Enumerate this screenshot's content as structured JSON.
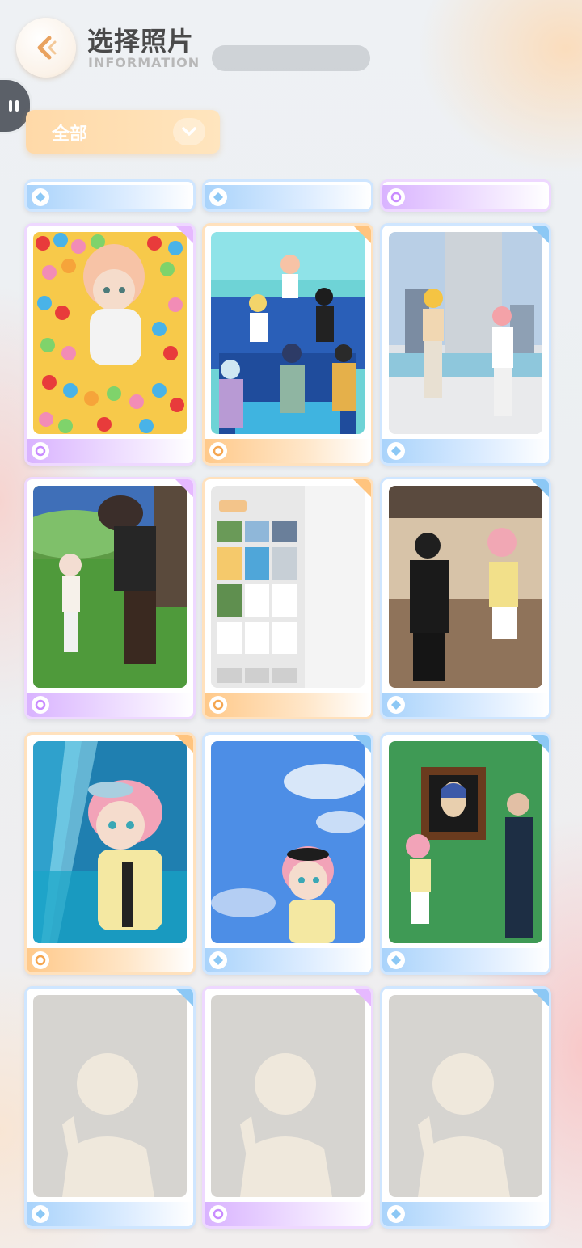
{
  "header": {
    "title": "选择照片",
    "subtitle": "INFORMATION"
  },
  "filter": {
    "selected": "全部"
  },
  "colors": {
    "accent_orange": "#ffd9a8",
    "frame_purple": "#e6b9ff",
    "frame_orange": "#ffc47e",
    "frame_blue": "#8cc8f5"
  },
  "grid": {
    "columns": 3,
    "cards": [
      {
        "frame": "blue",
        "content": "partial"
      },
      {
        "frame": "blue",
        "content": "partial"
      },
      {
        "frame": "purple",
        "content": "partial"
      },
      {
        "frame": "purple",
        "content": "ball-pit"
      },
      {
        "frame": "orange",
        "content": "group-photo"
      },
      {
        "frame": "blue",
        "content": "city-pair"
      },
      {
        "frame": "purple",
        "content": "park-pair"
      },
      {
        "frame": "orange",
        "content": "app-screenshot"
      },
      {
        "frame": "blue",
        "content": "mall-pair"
      },
      {
        "frame": "orange",
        "content": "cyber-portrait"
      },
      {
        "frame": "blue",
        "content": "sky-selfie"
      },
      {
        "frame": "blue",
        "content": "museum-pair"
      },
      {
        "frame": "blue",
        "content": "empty-slot"
      },
      {
        "frame": "purple",
        "content": "empty-slot"
      },
      {
        "frame": "blue",
        "content": "empty-slot"
      }
    ]
  }
}
